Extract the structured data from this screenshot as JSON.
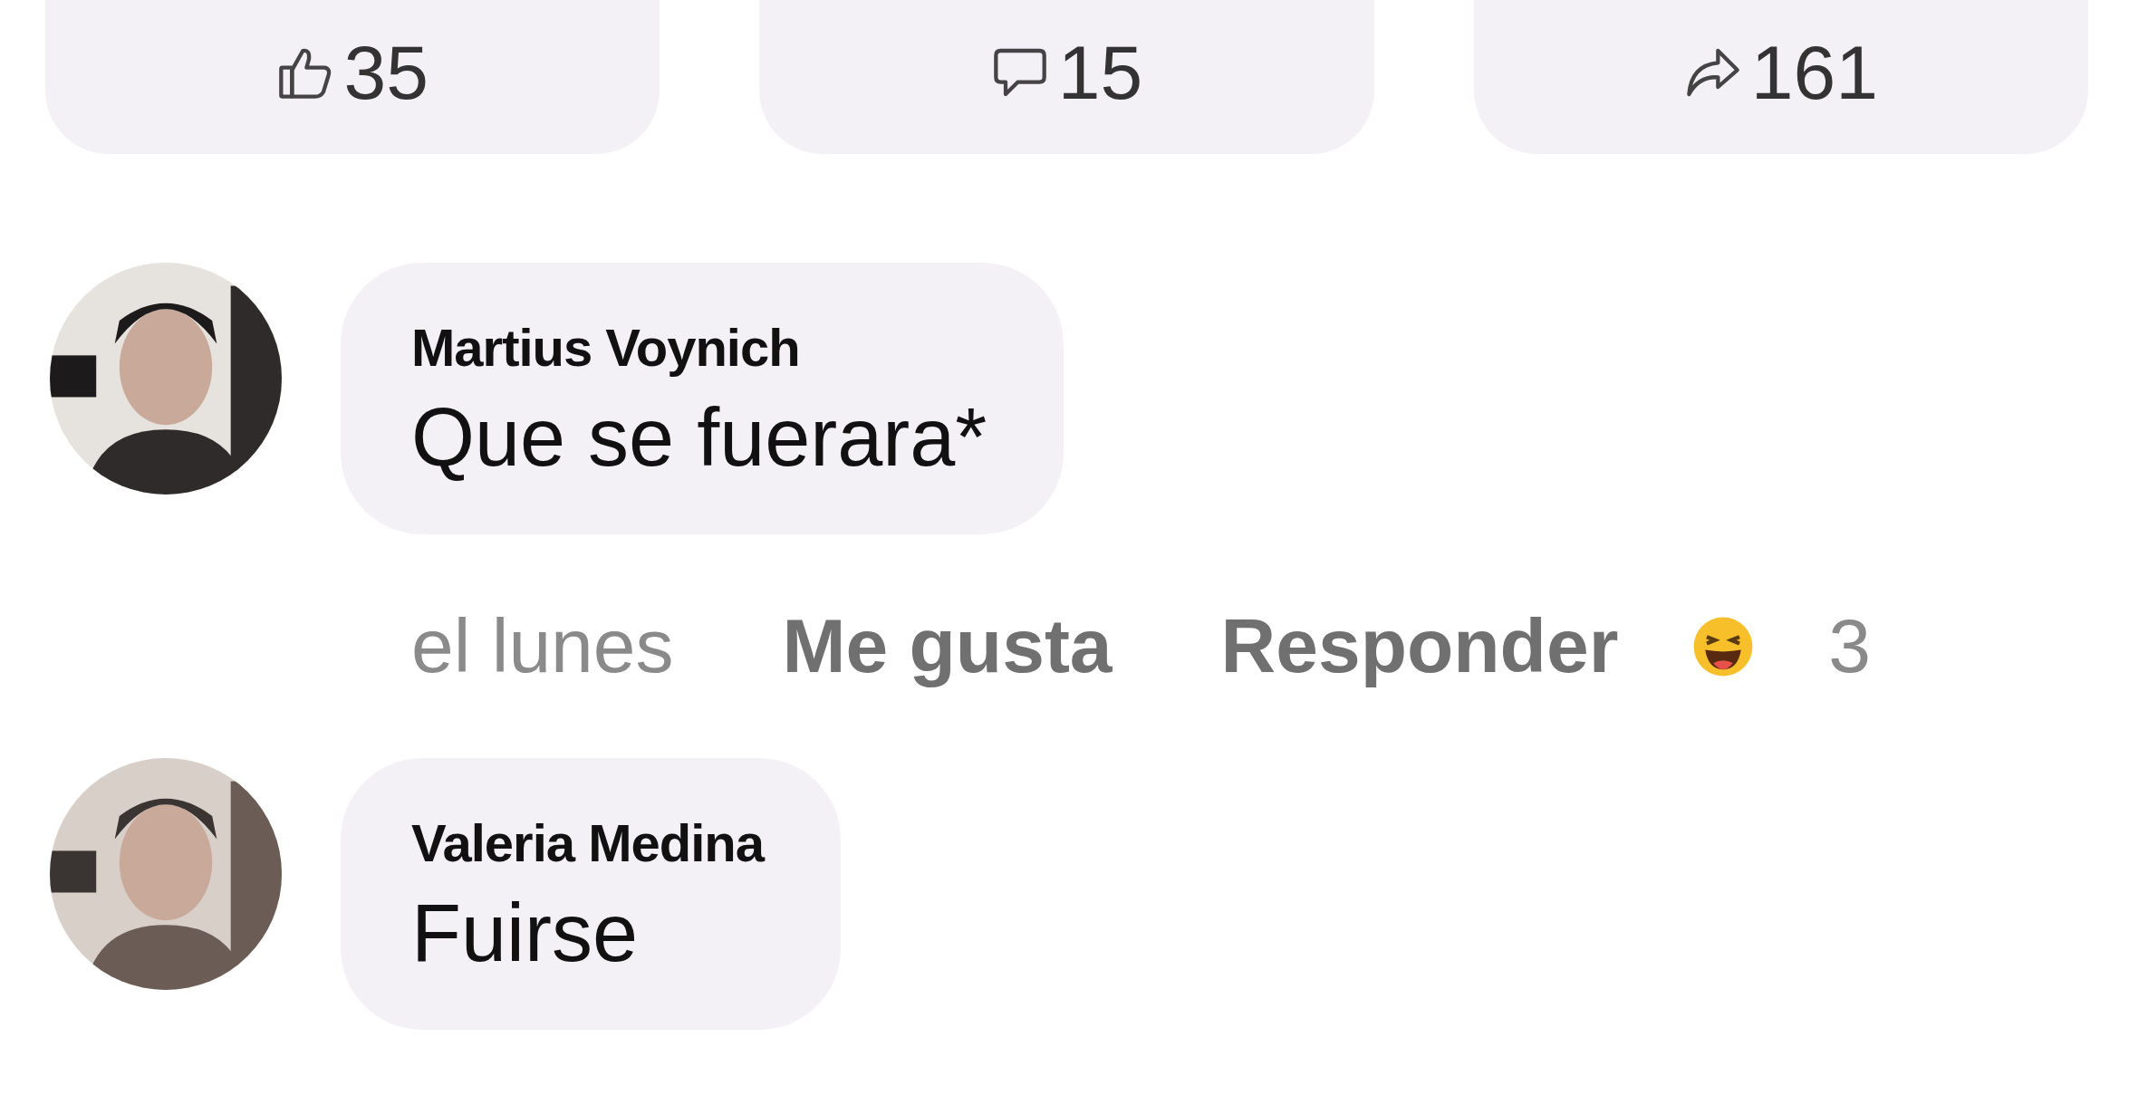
{
  "actions": [
    {
      "kind": "like",
      "count": "35"
    },
    {
      "kind": "comment",
      "count": "15"
    },
    {
      "kind": "share",
      "count": "161"
    }
  ],
  "comments": [
    {
      "author": "Martius Voynich",
      "text": "Que se fuerara*",
      "meta": {
        "time": "el lunes",
        "like": "Me gusta",
        "reply": "Responder",
        "reaction": {
          "kind": "laugh",
          "count": "3"
        }
      }
    },
    {
      "author": "Valeria Medina",
      "text": "Fuirse"
    }
  ]
}
